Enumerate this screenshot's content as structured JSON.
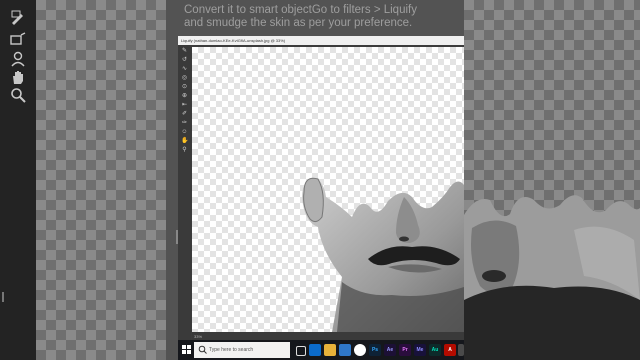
{
  "instruction": {
    "line1": "Convert it to smart objectGo to filters > Liquify",
    "line2": "and smudge the skin as per your preference."
  },
  "liquify": {
    "title": "Liquify (nathan-dumlao-KEe-KvtGfIA-unsplash.jpg @ 33%)",
    "zoom": "33%"
  },
  "taskbar": {
    "search_placeholder": "Type here to search",
    "apps": [
      {
        "name": "task-view",
        "label": "",
        "color": "#15171c"
      },
      {
        "name": "edge",
        "label": "",
        "color": "#0b6bcb"
      },
      {
        "name": "file-explorer",
        "label": "",
        "color": "#e8b23a"
      },
      {
        "name": "mail",
        "label": "",
        "color": "#2f77c9"
      },
      {
        "name": "chrome",
        "label": "",
        "color": "#ffffff"
      },
      {
        "name": "photoshop",
        "label": "Ps",
        "color": "#0e2236"
      },
      {
        "name": "after-effects",
        "label": "Ae",
        "color": "#1c1035"
      },
      {
        "name": "premiere",
        "label": "Pr",
        "color": "#2a0d3d"
      },
      {
        "name": "media-encoder",
        "label": "Me",
        "color": "#18113a"
      },
      {
        "name": "audition",
        "label": "Au",
        "color": "#0d2a2a"
      },
      {
        "name": "acrobat",
        "label": "A",
        "color": "#b30b00"
      },
      {
        "name": "extra-app",
        "label": "",
        "color": "#4a4a4a"
      }
    ]
  },
  "colors": {
    "panel": "#535353",
    "toolbar": "#232323",
    "taskbar": "#15171c"
  }
}
